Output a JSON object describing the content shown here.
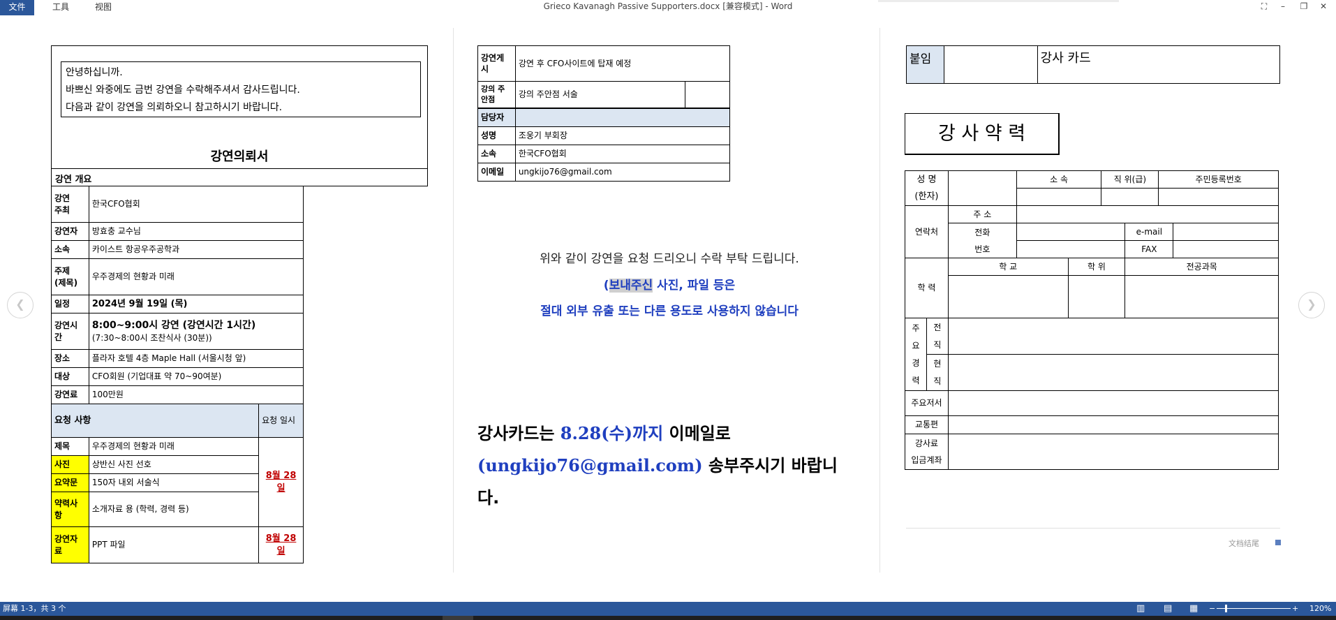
{
  "titlebar": {
    "menu": [
      "文件",
      "工具",
      "视图"
    ],
    "title": "Grieco Kavanagh Passive Supporters.docx [兼容模式] - Word"
  },
  "page1": {
    "greeting": [
      "안녕하십니까.",
      "바쁘신 와중에도 금번 강연을 수락해주셔서 감사드립니다.",
      "다음과 같이 강연을 의뢰하오니 참고하시기 바랍니다."
    ],
    "doc_title": "강연의뢰서",
    "overview": "강연 개요",
    "rows": [
      {
        "label": "강연\n주최",
        "value": "한국CFO협회"
      },
      {
        "label": "강연자",
        "value": "방효충 교수님"
      },
      {
        "label": "소속",
        "value": "카이스트 항공우주공학과"
      },
      {
        "label": "주제\n(제목)",
        "value": "우주경제의 현황과 미래"
      },
      {
        "label": "일정",
        "value": "2024년 9월 19일 (목)"
      },
      {
        "label": "강연시\n간",
        "value": "8:00~9:00시 강연 (강연시간 1시간)",
        "sub": "(7:30~8:00시 조찬식사 (30분))"
      },
      {
        "label": "장소",
        "value": "플라자 호텔 4층 Maple Hall (서울시청 앞)"
      },
      {
        "label": "대상",
        "value": "CFO회원 (기업대표 약 70~90여분)"
      },
      {
        "label": "강연료",
        "value": "100만원"
      }
    ],
    "req_header": "요청 사항",
    "req_date_header": "요청 일시",
    "req_rows": [
      {
        "label": "제목",
        "value": "우주경제의 현황과 미래"
      },
      {
        "label": "사진",
        "value": "상반신 사진 선호"
      },
      {
        "label": "요약문",
        "value": "150자 내외 서술식"
      },
      {
        "label": "약력사\n항",
        "value": "소개자료 용 (학력, 경력 등)"
      },
      {
        "label": "강연자\n료",
        "value": "PPT 파일"
      }
    ],
    "due1": "8월 28\n일",
    "due2": "8월 28\n일"
  },
  "page2": {
    "rows": [
      {
        "label": "강연게\n시",
        "value": "강연 후 CFO사이트에 탑재 예정"
      },
      {
        "label": "강의 주\n안점",
        "value": "강의 주안점 서술"
      }
    ],
    "manager": "담당자",
    "contacts": [
      {
        "label": "성명",
        "value": "조웅기 부회장"
      },
      {
        "label": "소속",
        "value": "한국CFO협회"
      },
      {
        "label": "이메일",
        "value": "ungkijo76@gmail.com"
      }
    ],
    "request_line": "위와 같이 강연을 요청 드리오니 수락 부탁 드립니다.",
    "note_open": "(",
    "note_sel": "보내주신",
    "note_rest": " 사진, 파일 등은",
    "note_line2": "절대 외부 유출 또는 다른 용도로 사용하지 않습니다",
    "card_a": "강사카드는 ",
    "card_date": "8.28(수)까지",
    "card_b": " 이메일로",
    "card_email": "(ungkijo76@gmail.com)",
    "card_c": " 송부주시기 바랍니",
    "card_d": "다."
  },
  "page3": {
    "attach_label": "붙임",
    "attach_title": "강사 카드",
    "bio_title": "강 사 약 력",
    "name_label": "성 명\n(한자)",
    "affil": "소 속",
    "position": "직 위(급)",
    "idno": "주민등록번호",
    "contact": "연락처",
    "address": "주 소",
    "phone": "전화\n번호",
    "email": "e-mail",
    "fax": "FAX",
    "edu": "학 력",
    "school": "학 교",
    "degree": "학 위",
    "major": "전공과목",
    "career": "주\n요\n경\n력",
    "prev": "전\n직",
    "curr": "현\n직",
    "works": "주요저서",
    "transport": "교통편",
    "fee": "강사료\n입금계좌",
    "doc_end": "文档结尾"
  },
  "statusbar": {
    "pages": "屏幕 1-3，共 3 个",
    "zoom": "120%"
  },
  "colors": {
    "accent": "#2b579a",
    "blue_text": "#1f3fbf",
    "red": "#c00000",
    "highlight": "#ffff00",
    "light_blue": "#dce6f2"
  }
}
